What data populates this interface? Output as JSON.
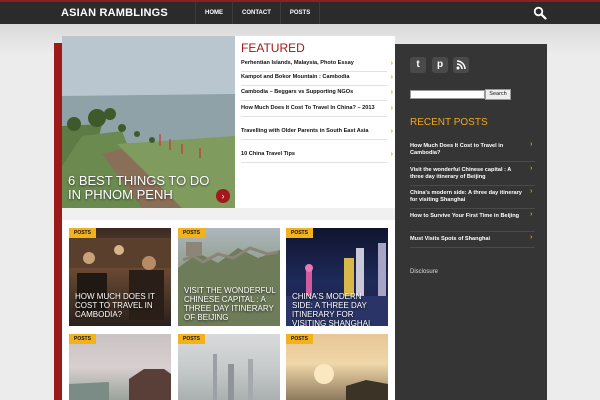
{
  "header": {
    "logo": "ASIAN RAMBLINGS",
    "nav": [
      "HOME",
      "CONTACT",
      "POSTS"
    ],
    "search_icon": "search-icon"
  },
  "hero": {
    "title": "6 BEST THINGS TO DO IN PHNOM PENH",
    "arrow": "›"
  },
  "featured": {
    "title": "FEATURED",
    "items": [
      "Perhentian Islands, Malaysia, Photo Essay",
      "Kampot and Bokor Mountain : Cambodia",
      "Cambodia – Beggars vs Supporting NGOs",
      "How Much Does It Cost To Travel In China? – 2013",
      "Travelling with Older Parents in South East Asia",
      "10 China Travel Tips"
    ]
  },
  "cards": [
    {
      "tag": "POSTS",
      "title": "HOW MUCH DOES IT COST TO TRAVEL IN CAMBODIA?"
    },
    {
      "tag": "POSTS",
      "title": "VISIT THE WONDERFUL CHINESE CAPITAL : A THREE DAY ITINERARY OF BEIJING"
    },
    {
      "tag": "POSTS",
      "title": "CHINA'S MODERN SIDE: A THREE DAY ITINERARY FOR VISITING SHANGHAI"
    },
    {
      "tag": "POSTS",
      "title": ""
    },
    {
      "tag": "POSTS",
      "title": ""
    },
    {
      "tag": "POSTS",
      "title": ""
    }
  ],
  "sidebar": {
    "social": [
      "t",
      "p",
      "rss"
    ],
    "search_button": "Search",
    "recent_title": "RECENT POSTS",
    "recent": [
      "How Much Does It Cost to Travel in Cambodia?",
      "Visit the wonderful Chinese capital : A three day itinerary of Beijing",
      "China's modern side: A three day itinerary for visiting Shanghai",
      "How to Survive Your First Time in Beijing",
      "Must Visits Spots of Shanghai"
    ],
    "disclosure": "Disclosure"
  },
  "colors": {
    "accent_red": "#a31818",
    "accent_orange": "#f0a81a",
    "dark": "#353535"
  }
}
